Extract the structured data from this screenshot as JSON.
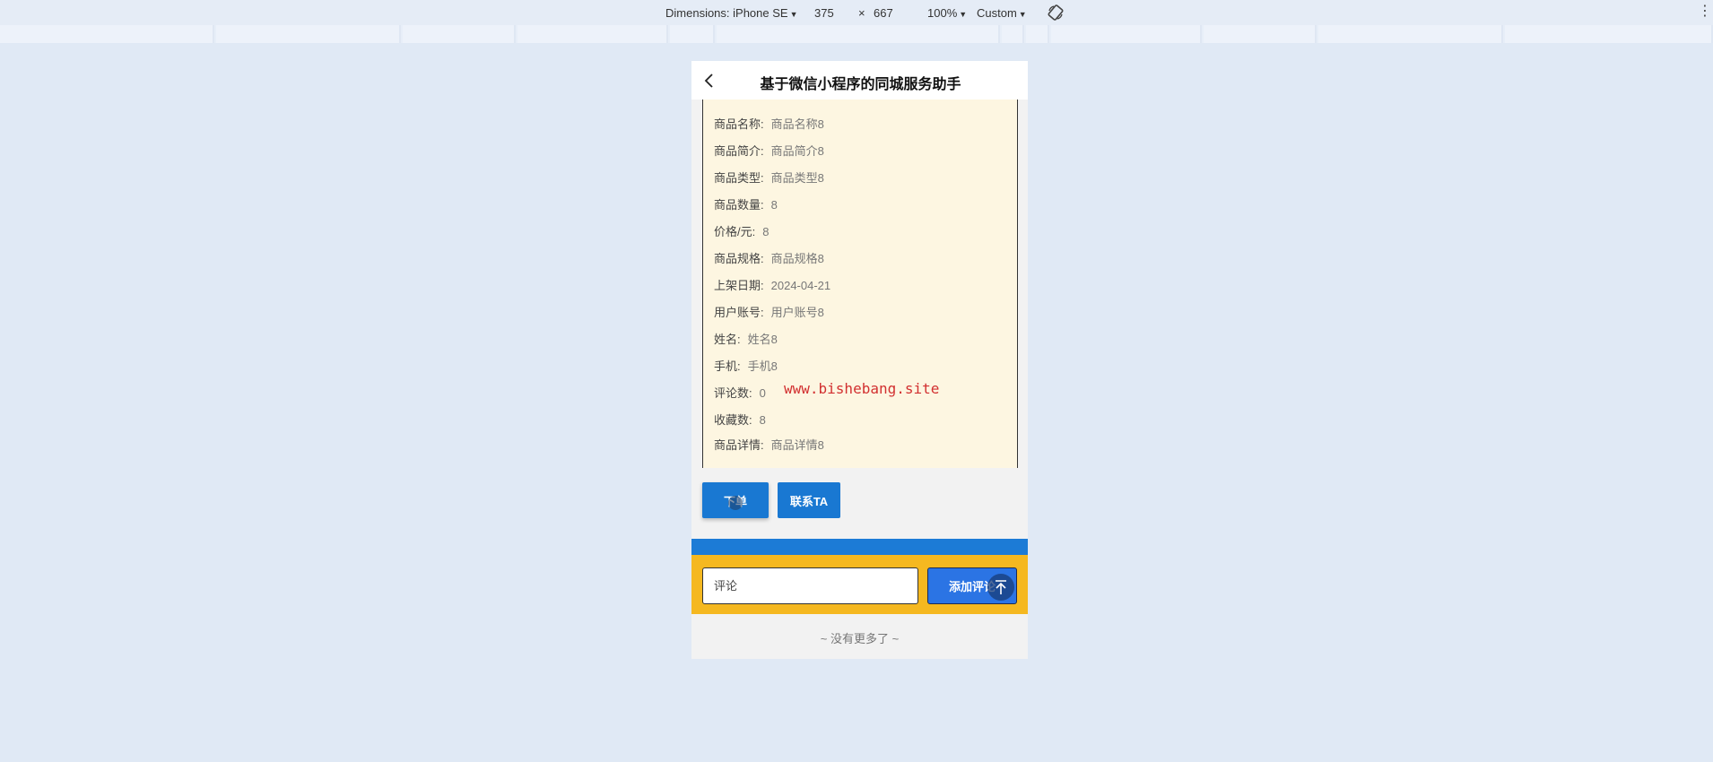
{
  "devtools": {
    "dimensions_label": "Dimensions: iPhone SE",
    "width_value": "375",
    "times_sign": "×",
    "height_value": "667",
    "zoom_label": "100%",
    "throttle_label": "Custom",
    "icons": [
      "caret-down-icon",
      "rotate-icon",
      "kebab-menu-icon"
    ]
  },
  "app": {
    "title": "基于微信小程序的同城服务助手",
    "back_icon": "chevron-left-icon"
  },
  "details": [
    {
      "label": "商品名称:",
      "value": "商品名称8"
    },
    {
      "label": "商品简介:",
      "value": "商品简介8"
    },
    {
      "label": "商品类型:",
      "value": "商品类型8"
    },
    {
      "label": "商品数量:",
      "value": "8"
    },
    {
      "label": "价格/元:",
      "value": "8"
    },
    {
      "label": "商品规格:",
      "value": "商品规格8"
    },
    {
      "label": "上架日期:",
      "value": "2024-04-21"
    },
    {
      "label": "用户账号:",
      "value": "用户账号8"
    },
    {
      "label": "姓名:",
      "value": "姓名8"
    },
    {
      "label": "手机:",
      "value": "手机8"
    },
    {
      "label": "评论数:",
      "value": "0"
    },
    {
      "label": "收藏数:",
      "value": "8"
    },
    {
      "label": "商品详情:",
      "value": "商品详情8"
    }
  ],
  "watermark": "www.bishebang.site",
  "actions": {
    "order_label": "下单",
    "contact_label": "联系TA"
  },
  "comment": {
    "placeholder": "评论",
    "add_label": "添加评论"
  },
  "footer": {
    "no_more": "~ 没有更多了 ~"
  },
  "colors": {
    "page_bg": "#e0e9f5",
    "info_bg": "#fdf6e1",
    "primary_blue": "#1978d2",
    "comment_bar": "#f5b820"
  }
}
